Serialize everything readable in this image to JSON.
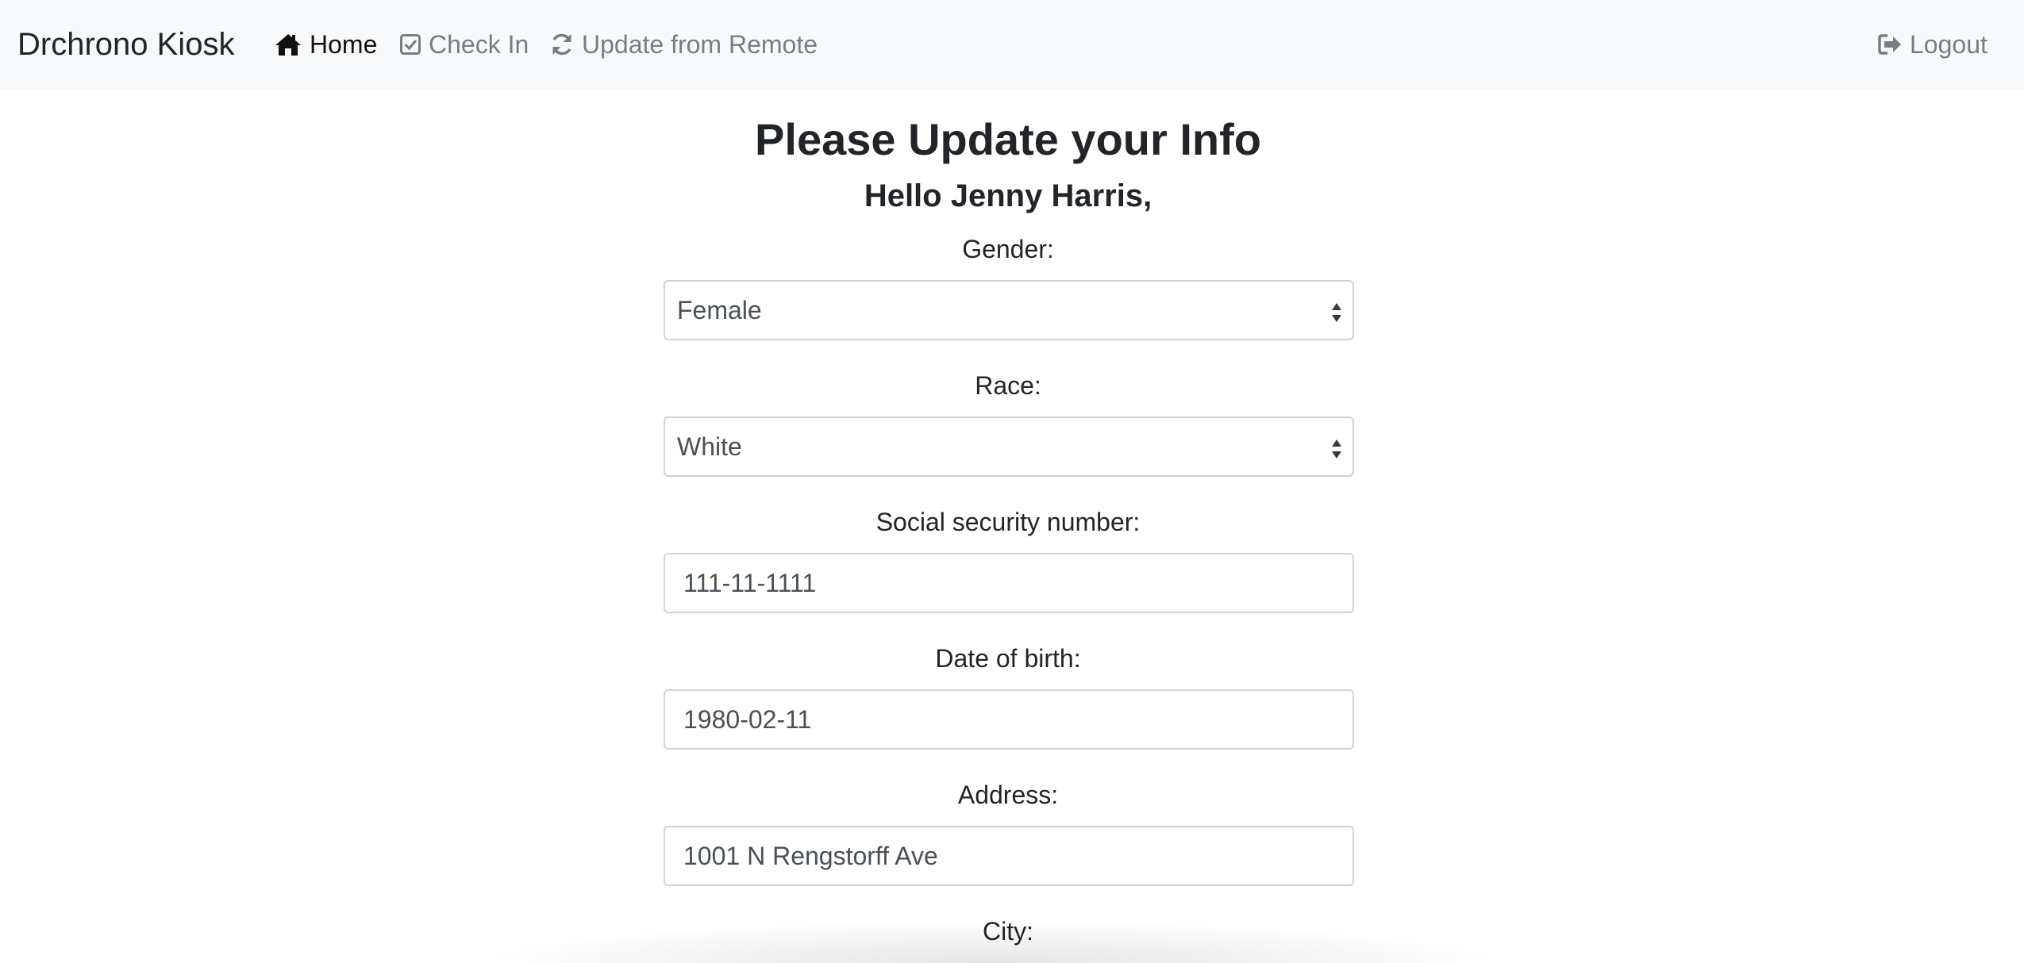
{
  "navbar": {
    "brand": "Drchrono Kiosk",
    "items": [
      {
        "label": "Home",
        "icon": "home-icon",
        "active": true
      },
      {
        "label": "Check In",
        "icon": "check-square-icon",
        "active": false
      },
      {
        "label": "Update from Remote",
        "icon": "refresh-icon",
        "active": false
      }
    ],
    "logout": {
      "label": "Logout",
      "icon": "sign-out-icon"
    }
  },
  "page": {
    "title": "Please Update your Info",
    "greeting": "Hello Jenny Harris,"
  },
  "form": {
    "gender": {
      "label": "Gender:",
      "value": "Female"
    },
    "race": {
      "label": "Race:",
      "value": "White"
    },
    "ssn": {
      "label": "Social security number:",
      "value": "111-11-1111"
    },
    "dob": {
      "label": "Date of birth:",
      "value": "1980-02-11"
    },
    "address": {
      "label": "Address:",
      "value": "1001 N Rengstorff Ave"
    },
    "city": {
      "label": "City:"
    }
  },
  "colors": {
    "navbar_bg": "#f8f9fa",
    "nav_inactive": "#7a7d80",
    "nav_active": "#111111",
    "input_border": "#ced4da",
    "input_text": "#495057"
  }
}
